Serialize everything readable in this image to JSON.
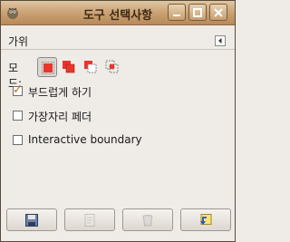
{
  "window": {
    "title": "도구 선택사항"
  },
  "panel": {
    "header": "가위"
  },
  "mode": {
    "label": "모드:",
    "options": [
      "replace-mode-icon",
      "add-mode-icon",
      "subtract-mode-icon",
      "intersect-mode-icon"
    ],
    "selected": 0
  },
  "options": [
    {
      "label": "부드럽게 하기",
      "checked": true
    },
    {
      "label": "가장자리 페더",
      "checked": false
    },
    {
      "label": "Interactive boundary",
      "checked": false
    }
  ],
  "bottom_buttons": [
    "save-icon",
    "restore-icon",
    "delete-icon",
    "reset-icon"
  ],
  "colors": {
    "accent": "#e8362b",
    "titlebar": "#c9a273",
    "check": "#d0641a"
  }
}
